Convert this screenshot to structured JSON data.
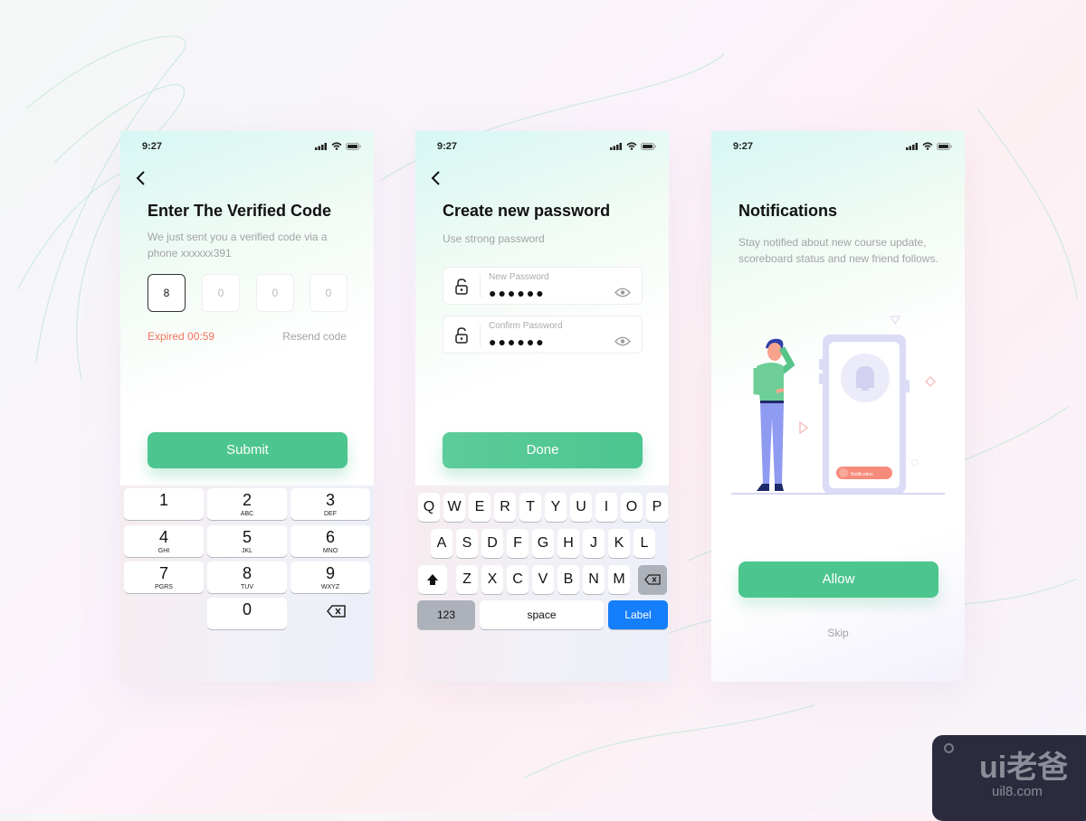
{
  "status": {
    "time": "9:27"
  },
  "colors": {
    "accent": "#4cc58f",
    "error": "#f3735a",
    "keyboard_blue": "#157efb"
  },
  "screen1": {
    "title": "Enter The Verified Code",
    "subtitle": "We just sent you a verified code via a phone xxxxxx391",
    "code": [
      "8",
      "0",
      "0",
      "0"
    ],
    "expired": "Expired 00:59",
    "resend": "Resend code",
    "submit": "Submit",
    "keypad": [
      {
        "d": "1",
        "l": ""
      },
      {
        "d": "2",
        "l": "ABC"
      },
      {
        "d": "3",
        "l": "DEF"
      },
      {
        "d": "4",
        "l": "GHI"
      },
      {
        "d": "5",
        "l": "JKL"
      },
      {
        "d": "6",
        "l": "MNO"
      },
      {
        "d": "7",
        "l": "PGRS"
      },
      {
        "d": "8",
        "l": "TUV"
      },
      {
        "d": "9",
        "l": "WXYZ"
      },
      {
        "d": "0",
        "l": ""
      }
    ]
  },
  "screen2": {
    "title": "Create new password",
    "subtitle": "Use strong password",
    "fields": [
      {
        "label": "New Password",
        "value": "●●●●●●"
      },
      {
        "label": "Confirm Password",
        "value": "●●●●●●"
      }
    ],
    "done": "Done",
    "keyboard": {
      "row1": [
        "Q",
        "W",
        "E",
        "R",
        "T",
        "Y",
        "U",
        "I",
        "O",
        "P"
      ],
      "row2": [
        "A",
        "S",
        "D",
        "F",
        "G",
        "H",
        "J",
        "K",
        "L"
      ],
      "row3": [
        "Z",
        "X",
        "C",
        "V",
        "B",
        "N",
        "M"
      ],
      "numbers": "123",
      "space": "space",
      "action": "Label"
    }
  },
  "screen3": {
    "title": "Notifications",
    "text": "Stay notified about new course update, scoreboard status and new friend follows.",
    "illustration_pill": "Notification",
    "allow": "Allow",
    "skip": "Skip"
  },
  "watermark": {
    "brand": "ui老爸",
    "url": "uil8.com"
  }
}
